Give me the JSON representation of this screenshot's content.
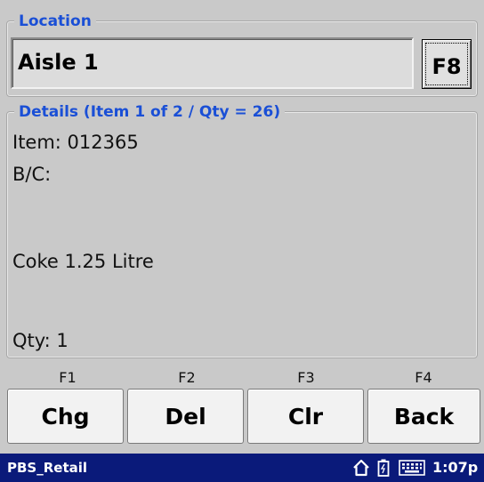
{
  "location": {
    "legend": "Location",
    "value": "Aisle 1",
    "f8_label": "F8"
  },
  "details": {
    "legend": "Details (Item 1 of 2 / Qty = 26)",
    "item": "Item: 012365",
    "barcode": "B/C:",
    "description": "Coke 1.25 Litre",
    "qty": "Qty: 1"
  },
  "function_keys": [
    {
      "key": "F1",
      "label": "Chg"
    },
    {
      "key": "F2",
      "label": "Del"
    },
    {
      "key": "F3",
      "label": "Clr"
    },
    {
      "key": "F4",
      "label": "Back"
    }
  ],
  "statusbar": {
    "app_name": "PBS_Retail",
    "time": "1:07p",
    "icons": [
      "home-icon",
      "battery-icon",
      "keyboard-icon"
    ],
    "background": "#0a1a7a"
  },
  "colors": {
    "legend_text": "#1a4fd6",
    "background": "#c9c9c9"
  }
}
